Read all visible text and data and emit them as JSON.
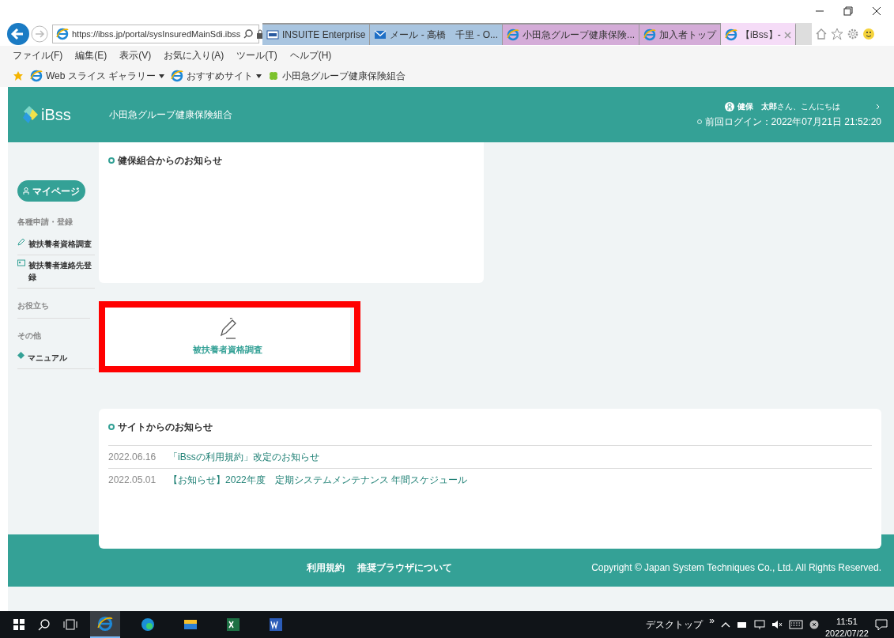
{
  "browser": {
    "address": "https://ibss.jp/portal/sysInsuredMainSdi.ibss",
    "tabs": [
      {
        "label": "INSUITE Enterprise",
        "kind": "app",
        "color": "#a9c5e0",
        "selected": false
      },
      {
        "label": "メール - 高橋　千里 - O...",
        "kind": "mail",
        "color": "#a9c5e0",
        "selected": false
      },
      {
        "label": "小田急グループ健康保険...",
        "kind": "ie",
        "color": "#d4acd8",
        "selected": false
      },
      {
        "label": "加入者トップ",
        "kind": "ie",
        "color": "#d4acd8",
        "selected": false
      },
      {
        "label": "【iBss】-",
        "kind": "ie",
        "color": "#f5dcf7",
        "selected": true
      }
    ],
    "menu": [
      "ファイル(F)",
      "編集(E)",
      "表示(V)",
      "お気に入り(A)",
      "ツール(T)",
      "ヘルプ(H)"
    ],
    "favorites": [
      {
        "label": "Web スライス ギャラリー",
        "kind": "ie",
        "dropdown": true
      },
      {
        "label": "おすすめサイト",
        "kind": "ie",
        "dropdown": true
      },
      {
        "label": "小田急グループ健康保険組合",
        "kind": "clover",
        "dropdown": false
      }
    ]
  },
  "site": {
    "logo": "iBss",
    "org": "小田急グループ健康保険組合",
    "greeting": "**健保　太郎**さん、こんにちは",
    "last_login": "前回ログイン：2022年07月21日 21:52:20",
    "sidebar": {
      "mypage": "マイページ",
      "sections": [
        {
          "heading": "各種申請・登録",
          "items": [
            {
              "label": "被扶養者資格調査",
              "kind": "pen"
            },
            {
              "label": "被扶養者連絡先登録",
              "kind": "card"
            }
          ]
        },
        {
          "heading": "お役立ち"
        },
        {
          "heading": "その他",
          "items": [
            {
              "label": "マニュアル",
              "kind": "diamond"
            }
          ]
        }
      ]
    },
    "union_news": {
      "title": "健保組合からのお知らせ"
    },
    "tile": {
      "label": "被扶養者資格調査",
      "highlighted": true
    },
    "site_news": {
      "title": "サイトからのお知らせ",
      "items": [
        {
          "date": "2022.06.16",
          "title": "「iBssの利用規約」改定のお知らせ"
        },
        {
          "date": "2022.05.01",
          "title": "【お知らせ】2022年度　定期システムメンテナンス 年間スケジュール"
        }
      ]
    },
    "footer": {
      "links": [
        "利用規約",
        "推奨ブラウザについて"
      ],
      "copyright": "Copyright © Japan System Techniques Co., Ltd. All Rights Reserved."
    }
  },
  "taskbar": {
    "apps": [
      {
        "kind": "ie",
        "selected": true
      },
      {
        "kind": "edge",
        "selected": false
      },
      {
        "kind": "folder",
        "selected": false
      },
      {
        "kind": "excel",
        "selected": false
      },
      {
        "kind": "word",
        "selected": false
      }
    ],
    "desktop": "デスクトップ",
    "more": "»",
    "time": "11:51",
    "date": "2022/07/22"
  }
}
